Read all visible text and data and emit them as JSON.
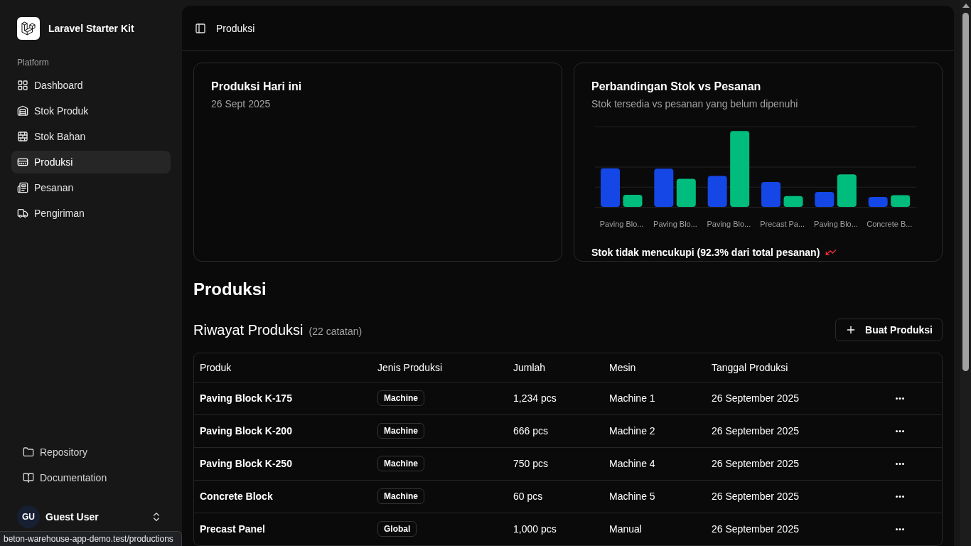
{
  "sidebar": {
    "app_name": "Laravel Starter Kit",
    "section_label": "Platform",
    "items": [
      {
        "label": "Dashboard",
        "selected": false
      },
      {
        "label": "Stok Produk",
        "selected": false
      },
      {
        "label": "Stok Bahan",
        "selected": false
      },
      {
        "label": "Produksi",
        "selected": true
      },
      {
        "label": "Pesanan",
        "selected": false
      },
      {
        "label": "Pengiriman",
        "selected": false
      }
    ],
    "footer_links": [
      {
        "label": "Repository"
      },
      {
        "label": "Documentation"
      }
    ],
    "user": {
      "initials": "GU",
      "name": "Guest User"
    }
  },
  "header": {
    "breadcrumb": "Produksi"
  },
  "today_card": {
    "title": "Produksi Hari ini",
    "date": "26 Sept 2025"
  },
  "stock_card": {
    "title": "Perbandingan Stok vs Pesanan",
    "subtitle": "Stok tersedia vs pesanan yang belum dipenuhi",
    "chart_labels": [
      "Paving Blo...",
      "Paving Blo...",
      "Paving Blo...",
      "Precast Pa...",
      "Paving Blo...",
      "Concrete B..."
    ],
    "footer": "Stok tidak mencukupi (92.3% dari total pesanan)"
  },
  "page_title": "Produksi",
  "history": {
    "title": "Riwayat Produksi",
    "count": "(22 catatan)",
    "button": "Buat Produksi",
    "table": {
      "columns": [
        "Produk",
        "Jenis Produksi",
        "Jumlah",
        "Mesin",
        "Tanggal Produksi"
      ],
      "rows": [
        {
          "product": "Paving Block K-175",
          "type": "Machine",
          "quantity": "1,234 pcs",
          "machine": "Machine 1",
          "date": "26 September 2025"
        },
        {
          "product": "Paving Block K-200",
          "type": "Machine",
          "quantity": "666 pcs",
          "machine": "Machine 2",
          "date": "26 September 2025"
        },
        {
          "product": "Paving Block K-250",
          "type": "Machine",
          "quantity": "750 pcs",
          "machine": "Machine 4",
          "date": "26 September 2025"
        },
        {
          "product": "Concrete Block",
          "type": "Machine",
          "quantity": "60 pcs",
          "machine": "Machine 5",
          "date": "26 September 2025"
        },
        {
          "product": "Precast Panel",
          "type": "Global",
          "quantity": "1,000 pcs",
          "machine": "Manual",
          "date": "26 September 2025"
        }
      ]
    }
  },
  "status_url": "beton-warehouse-app-demo.test/productions"
}
